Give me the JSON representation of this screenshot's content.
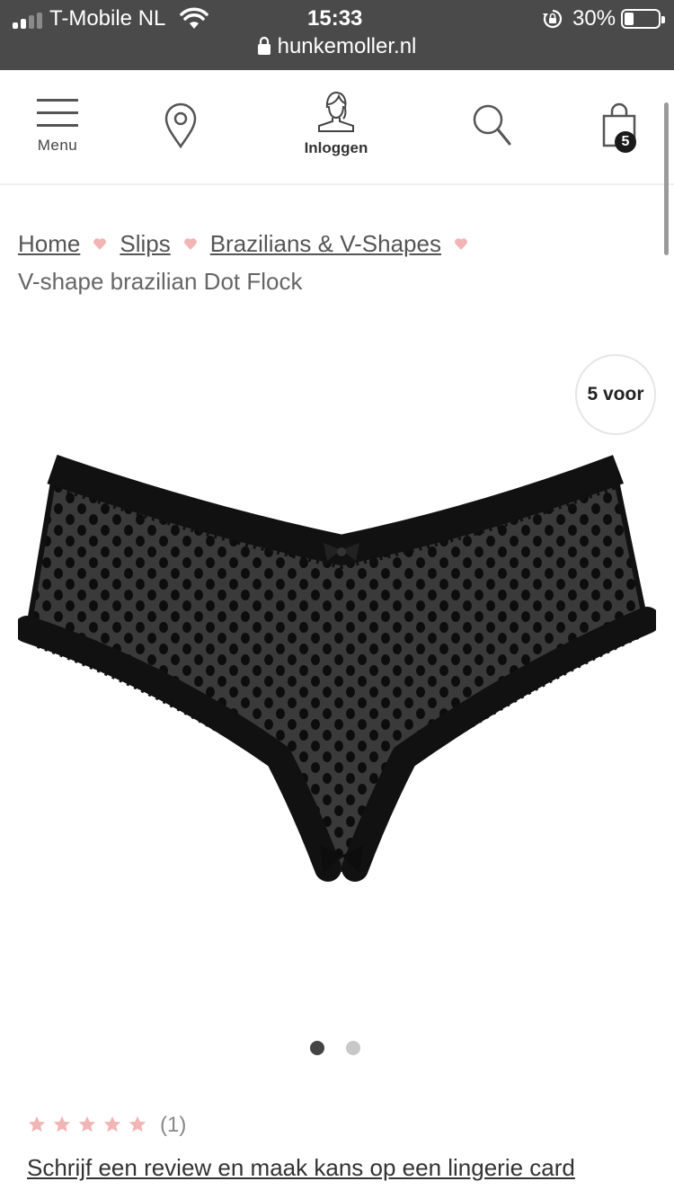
{
  "status_bar": {
    "carrier": "T-Mobile NL",
    "time": "15:33",
    "battery": "30%",
    "battery_level": 0.3,
    "url": "hunkemoller.nl"
  },
  "header": {
    "menu_label": "Menu",
    "login_label": "Inloggen",
    "bag_count": "5",
    "icons": [
      "menu-icon",
      "store-locator-icon",
      "account-icon",
      "search-icon",
      "shopping-bag-icon"
    ]
  },
  "breadcrumb": {
    "items": [
      "Home",
      "Slips",
      "Brazilians & V-Shapes"
    ],
    "current": "V-shape brazilian Dot Flock"
  },
  "product": {
    "badge": "5 voor",
    "carousel_total": 2,
    "carousel_active": 1
  },
  "rating": {
    "stars": 5,
    "count_text": "(1)",
    "review_link": "Schrijf een review en maak kans op een lingerie card"
  },
  "colors": {
    "status_bar": "#4a4a4a",
    "heart": "#f2b5b5",
    "text": "#333333"
  }
}
